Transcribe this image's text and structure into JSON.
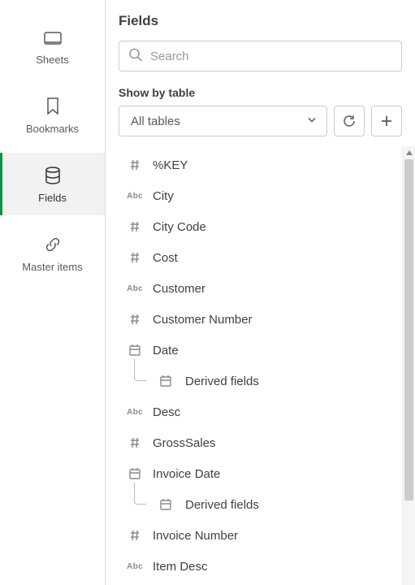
{
  "sidebar": {
    "items": [
      {
        "label": "Sheets",
        "name": "sidebar-item-sheets"
      },
      {
        "label": "Bookmarks",
        "name": "sidebar-item-bookmarks"
      },
      {
        "label": "Fields",
        "name": "sidebar-item-fields"
      },
      {
        "label": "Master items",
        "name": "sidebar-item-master-items"
      }
    ]
  },
  "panel": {
    "title": "Fields",
    "search_placeholder": "Search",
    "show_by_label": "Show by table",
    "table_select_value": "All tables"
  },
  "fields": [
    {
      "type": "hash",
      "label": "%KEY"
    },
    {
      "type": "abc",
      "label": "City"
    },
    {
      "type": "hash",
      "label": "City Code"
    },
    {
      "type": "hash",
      "label": "Cost"
    },
    {
      "type": "abc",
      "label": "Customer"
    },
    {
      "type": "hash",
      "label": "Customer Number"
    },
    {
      "type": "cal",
      "label": "Date"
    },
    {
      "type": "calp",
      "label": "Derived fields",
      "child": true
    },
    {
      "type": "abc",
      "label": "Desc"
    },
    {
      "type": "hash",
      "label": "GrossSales"
    },
    {
      "type": "cal",
      "label": "Invoice Date"
    },
    {
      "type": "calp",
      "label": "Derived fields",
      "child": true
    },
    {
      "type": "hash",
      "label": "Invoice Number"
    },
    {
      "type": "abc",
      "label": "Item Desc"
    }
  ]
}
